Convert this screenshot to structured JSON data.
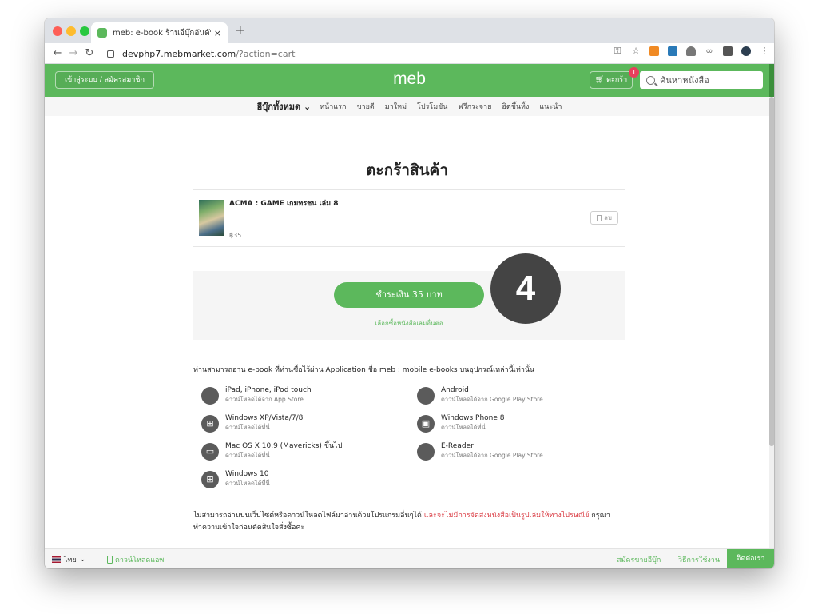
{
  "browser": {
    "tab_title": "meb: e-book ร้านอีบุ๊กอันดับ 1 (พ...",
    "tab_close": "×",
    "new_tab": "+",
    "url_host": "devphp7.mebmarket.com",
    "url_path": "/?action=cart"
  },
  "header": {
    "login_label": "เข้าสู่ระบบ / สมัครสมาชิก",
    "logo": "meb",
    "cart_label": "ตะกร้า",
    "cart_count": "1",
    "search_placeholder": "ค้นหาหนังสือ"
  },
  "nav": {
    "all_ebooks": "อีบุ๊กทั้งหมด",
    "items": [
      "หน้าแรก",
      "ขายดี",
      "มาใหม่",
      "โปรโมชัน",
      "ฟรีกระจาย",
      "ฮิตขึ้นหิ้ง",
      "แนะนำ"
    ]
  },
  "cart": {
    "title": "ตะกร้าสินค้า",
    "item_title": "ACMA : GAME เกมทรชน เล่ม 8",
    "item_price": "฿35",
    "delete_label": "ลบ",
    "pay_label": "ชำระเงิน 35 บาท",
    "continue_label": "เลือกซื้อหนังสือเล่มอื่นต่อ",
    "step_number": "4"
  },
  "info": {
    "intro": "ท่านสามารถอ่าน e-book ที่ท่านซื้อไว้ผ่าน Application ชื่อ meb : mobile e-books บนอุปกรณ์เหล่านี้เท่านั้น",
    "platforms": [
      {
        "name": "iPad, iPhone, iPod touch",
        "sub": "ดาวน์โหลดได้จาก App Store",
        "icon": "apple-icon"
      },
      {
        "name": "Android",
        "sub": "ดาวน์โหลดได้จาก Google Play Store",
        "icon": "android-icon"
      },
      {
        "name": "Windows XP/Vista/7/8",
        "sub": "ดาวน์โหลดได้ที่นี่",
        "icon": "windows-icon"
      },
      {
        "name": "Windows Phone 8",
        "sub": "ดาวน์โหลดได้ที่นี่",
        "icon": "windows-phone-icon"
      },
      {
        "name": "Mac OS X 10.9 (Mavericks) ขึ้นไป",
        "sub": "ดาวน์โหลดได้ที่นี่",
        "icon": "mac-icon"
      },
      {
        "name": "E-Reader",
        "sub": "ดาวน์โหลดได้จาก Google Play Store",
        "icon": "ereader-icon"
      },
      {
        "name": "Windows 10",
        "sub": "ดาวน์โหลดได้ที่นี่",
        "icon": "windows10-icon"
      }
    ],
    "notice_start": "ไม่สามารถอ่านบนเว็บไซต์หรือดาวน์โหลดไฟล์มาอ่านด้วยโปรแกรมอื่นๆได้ ",
    "notice_red": "และจะไม่มีการจัดส่งหนังสือเป็นรูปเล่มให้ทางไปรษณีย์",
    "notice_end": " กรุณาทำความเข้าใจก่อนตัดสินใจสั่งซื้อค่ะ"
  },
  "footer": {
    "language": "ไทย",
    "download_app": "ดาวน์โหลดแอพ",
    "sell_ebook": "สมัครขายอีบุ๊ก",
    "how_to": "วิธีการใช้งาน",
    "contact": "ติดต่อเรา"
  },
  "colors": {
    "brand_green": "#5cb85c",
    "badge_red": "#e83e5c",
    "notice_red": "#d9363e"
  }
}
